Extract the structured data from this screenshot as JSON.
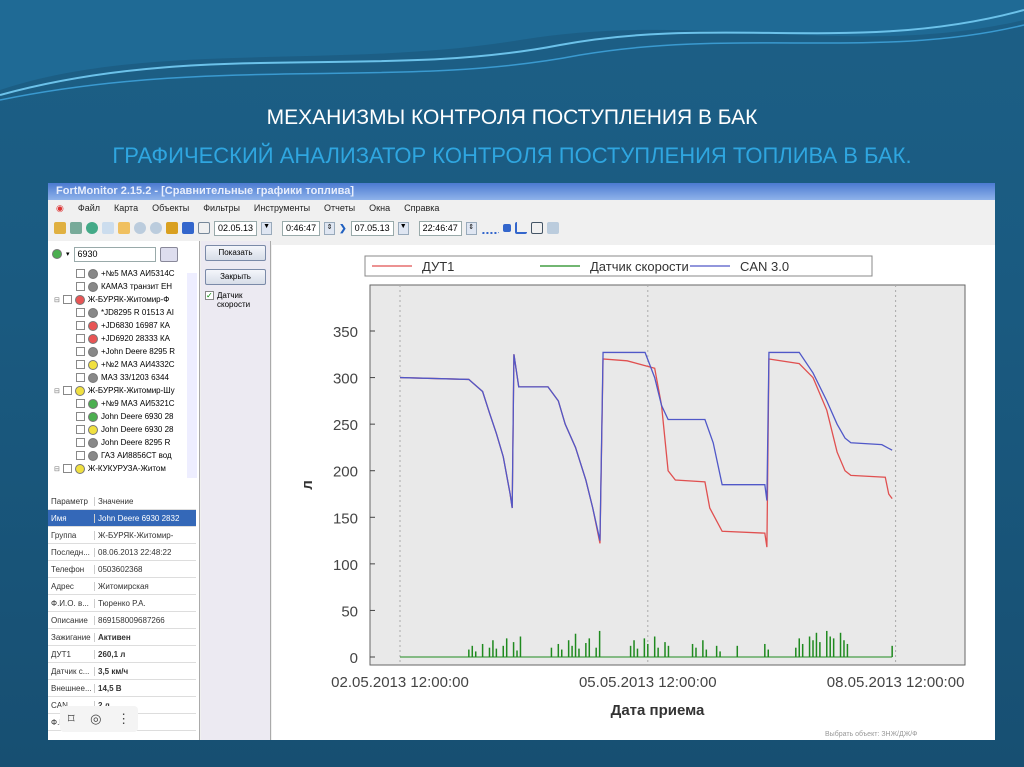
{
  "slide": {
    "title": "МЕХАНИЗМЫ КОНТРОЛЯ ПОСТУПЛЕНИЯ В БАК",
    "subtitle": "ГРАФИЧЕСКИЙ АНАЛИЗАТОР КОНТРОЛЯ ПОСТУПЛЕНИЯ ТОПЛИВА В БАК."
  },
  "app": {
    "title": "FortMonitor 2.15.2 - [Сравнительные графики топлива]",
    "menu": [
      "Файл",
      "Карта",
      "Объекты",
      "Фильтры",
      "Инструменты",
      "Отчеты",
      "Окна",
      "Справка"
    ],
    "toolbar": {
      "date_from": "02.05.13",
      "time_from": "0:46:47",
      "date_to": "07.05.13",
      "time_to": "22:46:47"
    },
    "search": "6930",
    "tree": [
      {
        "label": "+№5 МАЗ АИ5314С",
        "color": "#888",
        "lvl": 2
      },
      {
        "label": "КАМАЗ транзит ЕН",
        "color": "#888",
        "lvl": 2
      },
      {
        "label": "Ж-БУРЯК-Житомир-Ф",
        "color": "#e85555",
        "lvl": 1
      },
      {
        "label": "*JD8295 R 01513 АІ",
        "color": "#888",
        "lvl": 2
      },
      {
        "label": "+JD6830 16987 КА",
        "color": "#e85555",
        "lvl": 2
      },
      {
        "label": "+JD6920 28333 КА",
        "color": "#e85555",
        "lvl": 2
      },
      {
        "label": "+John Deere 8295 R",
        "color": "#888",
        "lvl": 2
      },
      {
        "label": "+№2 МАЗ АИ4332С",
        "color": "#f0e040",
        "lvl": 2
      },
      {
        "label": "МАЗ 33/1203 6344",
        "color": "#888",
        "lvl": 2
      },
      {
        "label": "Ж-БУРЯК-Житомир-Шу",
        "color": "#f0e040",
        "lvl": 1
      },
      {
        "label": "+№9 МАЗ АИ5321С",
        "color": "#4caf50",
        "lvl": 2
      },
      {
        "label": "John Deere 6930 28",
        "color": "#4caf50",
        "lvl": 2
      },
      {
        "label": "John Deere 6930 28",
        "color": "#f0e040",
        "lvl": 2
      },
      {
        "label": "John Deere 8295 R",
        "color": "#888",
        "lvl": 2
      },
      {
        "label": "ГАЗ АИ8856СТ вод",
        "color": "#888",
        "lvl": 2
      },
      {
        "label": "Ж-КУКУРУЗА-Житом",
        "color": "#f0e040",
        "lvl": 1
      }
    ],
    "params_header": [
      "Параметр",
      "Значение"
    ],
    "params": [
      [
        "Имя",
        "John Deere 6930 2832"
      ],
      [
        "Группа",
        "Ж-БУРЯК-Житомир-"
      ],
      [
        "Последн...",
        "08.06.2013 22:48:22"
      ],
      [
        "Телефон",
        "0503602368"
      ],
      [
        "Адрес",
        "Житомирская"
      ],
      [
        "Ф.И.О. в...",
        "Тюренко Р.А."
      ],
      [
        "Описание",
        "869158009687266"
      ],
      [
        "Зажигание",
        "Активен"
      ],
      [
        "ДУТ1",
        "260,1 л"
      ],
      [
        "Датчик с...",
        "3,5 км/ч"
      ],
      [
        "Внешнее...",
        "14,5 В"
      ],
      [
        "CAN...",
        "2 л"
      ],
      [
        "Ф.И.О.",
        "...ко Ю.В."
      ]
    ],
    "buttons": {
      "show": "Показать",
      "close": "Закрыть"
    },
    "speed_checkbox": "Датчик скорости"
  },
  "chart_data": {
    "type": "line",
    "xlabel": "Дата приема",
    "ylabel": "л",
    "ylim": [
      0,
      350
    ],
    "yticks": [
      0,
      50,
      100,
      150,
      200,
      250,
      300,
      350
    ],
    "x_unit": "hours since 02.05.2013 00:00",
    "xlim": [
      3.3,
      176
    ],
    "xticks": [
      {
        "h": 12,
        "label": "02.05.2013 12:00:00"
      },
      {
        "h": 84,
        "label": "05.05.2013 12:00:00"
      },
      {
        "h": 156,
        "label": "08.05.2013 12:00:00"
      }
    ],
    "legend": "top",
    "series": [
      {
        "name": "ДУТ1",
        "color": "#e05050",
        "points": [
          [
            12,
            300
          ],
          [
            32,
            298
          ],
          [
            36,
            285
          ],
          [
            38,
            262
          ],
          [
            40,
            240
          ],
          [
            42,
            215
          ],
          [
            44,
            175
          ],
          [
            44.6,
            160
          ],
          [
            45.1,
            325
          ],
          [
            46.5,
            290
          ],
          [
            55,
            290
          ],
          [
            58,
            275
          ],
          [
            60,
            250
          ],
          [
            63,
            225
          ],
          [
            66,
            190
          ],
          [
            68,
            160
          ],
          [
            70.1,
            122
          ],
          [
            71,
            320
          ],
          [
            78,
            318
          ],
          [
            86,
            310
          ],
          [
            88,
            270
          ],
          [
            89.9,
            200
          ],
          [
            92,
            190
          ],
          [
            100.6,
            188
          ],
          [
            102,
            160
          ],
          [
            105.6,
            135
          ],
          [
            118,
            133
          ],
          [
            118.6,
            118
          ],
          [
            119.2,
            320
          ],
          [
            128,
            315
          ],
          [
            132,
            300
          ],
          [
            136,
            265
          ],
          [
            139,
            220
          ],
          [
            141.3,
            200
          ],
          [
            143,
            195
          ],
          [
            153,
            193
          ],
          [
            154,
            175
          ],
          [
            155,
            170
          ]
        ]
      },
      {
        "name": "Датчик скорости",
        "color": "#1f8a1f",
        "spikes": [
          [
            32,
            8
          ],
          [
            33,
            12
          ],
          [
            34,
            6
          ],
          [
            36,
            14
          ],
          [
            38,
            10
          ],
          [
            39,
            18
          ],
          [
            40,
            9
          ],
          [
            42,
            12
          ],
          [
            43,
            20
          ],
          [
            45,
            16
          ],
          [
            46,
            7
          ],
          [
            47,
            22
          ],
          [
            56,
            10
          ],
          [
            58,
            14
          ],
          [
            59,
            8
          ],
          [
            61,
            18
          ],
          [
            62,
            12
          ],
          [
            63,
            25
          ],
          [
            64,
            9
          ],
          [
            66,
            15
          ],
          [
            67,
            20
          ],
          [
            69,
            10
          ],
          [
            70,
            28
          ],
          [
            79,
            12
          ],
          [
            80,
            18
          ],
          [
            81,
            9
          ],
          [
            83,
            20
          ],
          [
            84,
            14
          ],
          [
            86,
            22
          ],
          [
            87,
            10
          ],
          [
            89,
            16
          ],
          [
            90,
            12
          ],
          [
            97,
            14
          ],
          [
            98,
            10
          ],
          [
            100,
            18
          ],
          [
            101,
            8
          ],
          [
            104,
            12
          ],
          [
            105,
            6
          ],
          [
            110,
            12
          ],
          [
            118,
            14
          ],
          [
            119,
            8
          ],
          [
            127,
            10
          ],
          [
            128,
            20
          ],
          [
            129,
            14
          ],
          [
            131,
            22
          ],
          [
            132,
            18
          ],
          [
            133,
            26
          ],
          [
            134,
            16
          ],
          [
            136,
            28
          ],
          [
            137,
            22
          ],
          [
            138,
            20
          ],
          [
            140,
            26
          ],
          [
            141,
            18
          ],
          [
            142,
            14
          ],
          [
            155,
            12
          ]
        ]
      },
      {
        "name": "CAN 3.0",
        "color": "#5058c8",
        "points": [
          [
            12,
            300
          ],
          [
            32,
            298
          ],
          [
            36,
            285
          ],
          [
            38,
            262
          ],
          [
            40,
            240
          ],
          [
            42,
            215
          ],
          [
            44,
            175
          ],
          [
            44.6,
            160
          ],
          [
            45.1,
            325
          ],
          [
            46.5,
            290
          ],
          [
            55,
            290
          ],
          [
            58,
            275
          ],
          [
            60,
            250
          ],
          [
            63,
            225
          ],
          [
            66,
            190
          ],
          [
            68,
            160
          ],
          [
            70.1,
            125
          ],
          [
            71,
            327
          ],
          [
            83.2,
            327
          ],
          [
            86,
            300
          ],
          [
            88,
            270
          ],
          [
            89.9,
            255
          ],
          [
            100.6,
            255
          ],
          [
            103,
            230
          ],
          [
            105.6,
            185
          ],
          [
            118,
            185
          ],
          [
            118.6,
            168
          ],
          [
            119.2,
            327
          ],
          [
            128,
            327
          ],
          [
            132,
            305
          ],
          [
            136,
            275
          ],
          [
            139,
            250
          ],
          [
            141.3,
            235
          ],
          [
            143,
            230
          ],
          [
            152,
            228
          ],
          [
            155,
            222
          ]
        ]
      }
    ]
  },
  "overlay_text": "Выбрать объект: ЗНЖ/ДЖ/Ф"
}
